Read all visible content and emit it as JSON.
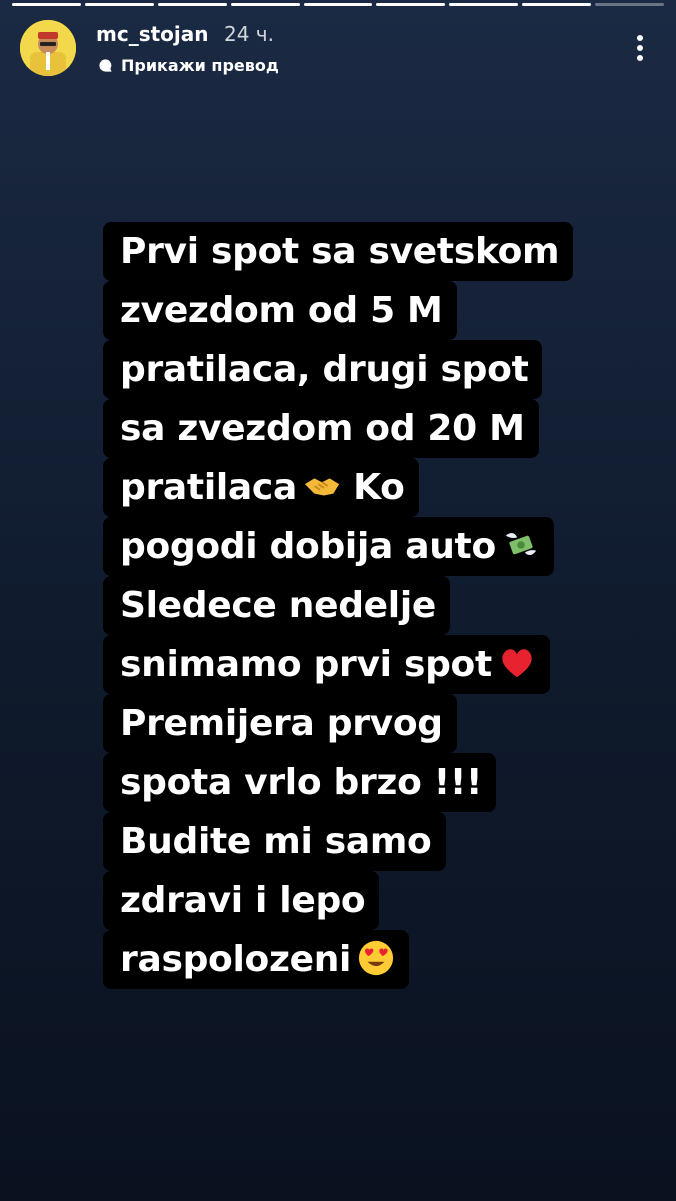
{
  "story": {
    "segments": [
      1,
      1,
      1,
      1,
      1,
      1,
      1,
      1,
      0
    ]
  },
  "header": {
    "username": "mc_stojan",
    "time": "24 ч.",
    "translate_label": "Прикажи превод",
    "avatar_icon": "avatar-icon",
    "more_icon": "more-options-icon"
  },
  "caption": {
    "lines": [
      {
        "text": "Prvi spot sa svetskom",
        "emoji": ""
      },
      {
        "text": "zvezdom od 5 M",
        "emoji": ""
      },
      {
        "text": "pratilaca, drugi spot",
        "emoji": ""
      },
      {
        "text": "sa zvezdom od 20 M",
        "emoji": ""
      },
      {
        "text": "pratilaca",
        "emoji": "handshake-emoji",
        "after": "Ko"
      },
      {
        "text": "pogodi dobija auto",
        "emoji": "money-with-wings-emoji"
      },
      {
        "text": "Sledece nedelje",
        "emoji": ""
      },
      {
        "text": "snimamo prvi spot",
        "emoji": "red-heart-emoji"
      },
      {
        "text": "Premijera prvog",
        "emoji": ""
      },
      {
        "text": "spota vrlo brzo !!!",
        "emoji": ""
      },
      {
        "text": "Budite mi samo",
        "emoji": ""
      },
      {
        "text": "zdravi i lepo",
        "emoji": ""
      },
      {
        "text": "raspolozeni",
        "emoji": "heart-eyes-emoji"
      }
    ]
  },
  "colors": {
    "caption_bg": "#000000",
    "caption_text": "#ffffff",
    "background_top": "#1b2a44",
    "background_bottom": "#0a1220"
  }
}
